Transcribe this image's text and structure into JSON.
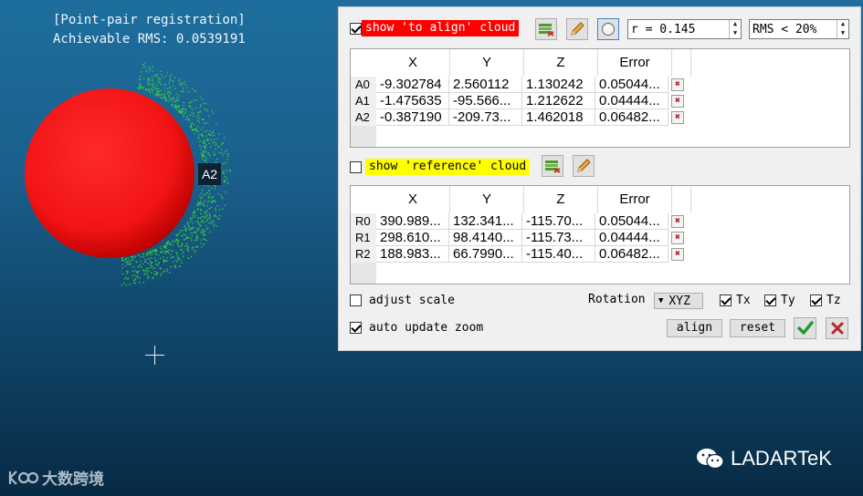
{
  "viewport": {
    "title_line1": "[Point-pair registration]",
    "title_line2": "Achievable RMS: 0.0539191",
    "point_label": "A2"
  },
  "panel": {
    "align_cloud_label": "show 'to align' cloud",
    "reference_cloud_label": "show 'reference' cloud",
    "radius_value": "r = 0.145",
    "rms_value": "RMS < 20%",
    "columns": [
      "X",
      "Y",
      "Z",
      "Error"
    ],
    "align_rows": [
      {
        "id": "A0",
        "x": "-9.302784",
        "y": "2.560112",
        "z": "1.130242",
        "error": "0.05044..."
      },
      {
        "id": "A1",
        "x": "-1.475635",
        "y": "-95.566...",
        "z": "1.212622",
        "error": "0.04444..."
      },
      {
        "id": "A2",
        "x": "-0.387190",
        "y": "-209.73...",
        "z": "1.462018",
        "error": "0.06482..."
      }
    ],
    "reference_rows": [
      {
        "id": "R0",
        "x": "390.989...",
        "y": "132.341...",
        "z": "-115.70...",
        "error": "0.05044..."
      },
      {
        "id": "R1",
        "x": "298.610...",
        "y": "98.4140...",
        "z": "-115.73...",
        "error": "0.04444..."
      },
      {
        "id": "R2",
        "x": "188.983...",
        "y": "66.7990...",
        "z": "-115.40...",
        "error": "0.06482..."
      }
    ],
    "delete_glyph": "✖",
    "adjust_scale_label": "adjust scale",
    "auto_update_zoom_label": "auto update zoom",
    "rotation_label": "Rotation",
    "rotation_value": "XYZ",
    "tx_label": "Tx",
    "ty_label": "Ty",
    "tz_label": "Tz",
    "align_button": "align",
    "reset_button": "reset"
  },
  "watermarks": {
    "left_text": "大数跨境",
    "right_text": "LADARTeK"
  },
  "colors": {
    "sphere": "#ff1a1a",
    "points": "#39d639",
    "align_highlight": "#ff0000",
    "reference_highlight": "#ffff00",
    "confirm_green": "#1e9c2e",
    "cancel_red": "#b3262b"
  }
}
